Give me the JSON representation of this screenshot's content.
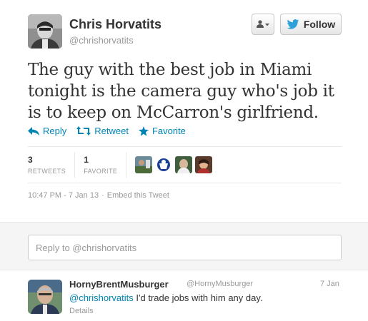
{
  "author": {
    "name": "Chris Horvatits",
    "handle": "@chrishorvatits"
  },
  "buttons": {
    "follow_label": "Follow"
  },
  "tweet": {
    "text": "The guy with the best job in Miami tonight is the camera guy who's job it is to keep on McCarron's girlfriend."
  },
  "actions": {
    "reply": "Reply",
    "retweet": "Retweet",
    "favorite": "Favorite"
  },
  "stats": {
    "retweets_count": "3",
    "retweets_label": "RETWEETS",
    "favorites_count": "1",
    "favorites_label": "FAVORITE"
  },
  "meta": {
    "timestamp": "10:47 PM - 7 Jan 13",
    "embed": "Embed this Tweet"
  },
  "reply_box": {
    "placeholder": "Reply to @chrishorvatits"
  },
  "reply": {
    "name": "HornyBrentMusburger",
    "handle": "@HornyMusburger",
    "time": "7 Jan",
    "mention": "@chrishorvatits",
    "text": " I'd trade jobs with him any day.",
    "details": "Details"
  },
  "colors": {
    "link": "#0084b4",
    "muted": "#999999"
  }
}
